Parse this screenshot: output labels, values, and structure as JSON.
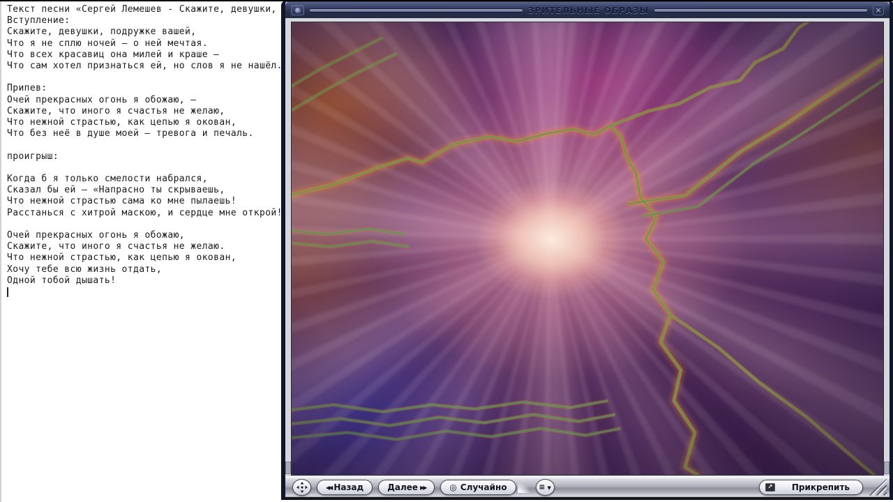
{
  "lyrics_panel": {
    "lines": [
      "Текст песни «Сергей Лемешев - Скажите, девушки, подружк",
      "Вступление:",
      "Скажите, девушки, подружке вашей,",
      "Что я не сплю ночей – о ней мечтая.",
      "Что всех красавиц она милей и краше –",
      "Что сам хотел признаться ей, но слов я не нашёл.",
      "",
      "Припев:",
      "Очей прекрасных огонь я обожаю, –",
      "Скажите, что иного я счастья не желаю,",
      "Что нежной страстью, как цепью я окован,",
      "Что без неё в душе моей – тревога и печаль.",
      "",
      "проигрыш:",
      "",
      "Когда б я только смелости набрался,",
      "Сказал бы ей – «Напрасно ты скрываешь,",
      "Что нежной страстью сама ко мне пылаешь!",
      "Расстанься с хитрой маскою, и сердце мне открой!».",
      "",
      "Очей прекрасных огонь я обожаю,",
      "Скажите, что иного я счастья не желаю.",
      "Что нежной страстью, как цепью я окован,",
      "Хочу тебе всю жизнь отдать,",
      "Одной тобой дышать!"
    ]
  },
  "player": {
    "title": "ЗРИТЕЛЬНЫЕ ОБРАЗЫ",
    "close_glyph": "×",
    "controls": {
      "back_prefix": "◀◀",
      "back_label": "Назад",
      "next_label": "Далее",
      "next_suffix": "▶▶",
      "random_icon": "◎",
      "random_label": "Случайно",
      "menu_icon": "≡",
      "menu_arrow": "▼",
      "attach_icon": "↗",
      "attach_label": "Прикрепить"
    },
    "colors": {
      "title_bar": "#2c3552",
      "frame_silver": "#d6d6de",
      "viz_line_orange": "#d98a2e",
      "viz_line_green": "#2f9e62"
    }
  }
}
